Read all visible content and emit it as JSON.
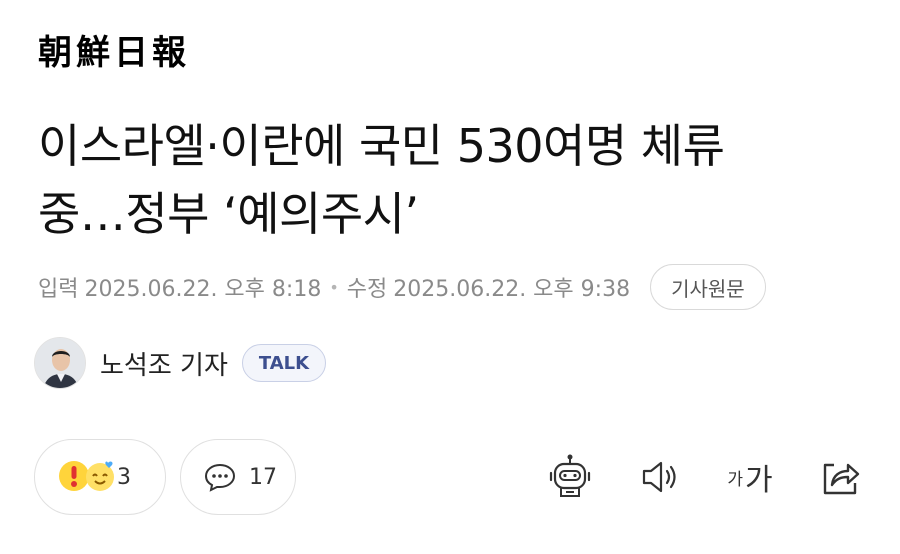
{
  "brand": {
    "logo_text": "朝鮮日報"
  },
  "article": {
    "headline_line1": "이스라엘·이란에 국민 530여명 체류",
    "headline_line2": "중…정부 ‘예의주시’",
    "published_label": "입력",
    "published_date": "2025.06.22. 오후 8:18",
    "updated_label": "수정",
    "updated_date": "2025.06.22. 오후 9:38",
    "original_button": "기사원문"
  },
  "author": {
    "name": "노석조 기자",
    "talk_button": "TALK"
  },
  "actions": {
    "reaction_count": "3",
    "comment_count": "17",
    "font_size_small": "가",
    "font_size_large": "가"
  },
  "icons": [
    "reaction-emoji-icon",
    "comment-bubble-icon",
    "ai-robot-icon",
    "speaker-icon",
    "font-size-icon",
    "share-icon"
  ],
  "colors": {
    "meta_gray": "#8a8a8a",
    "talk_blue": "#3d4f8f",
    "emoji_yellow": "#ffd43b"
  }
}
